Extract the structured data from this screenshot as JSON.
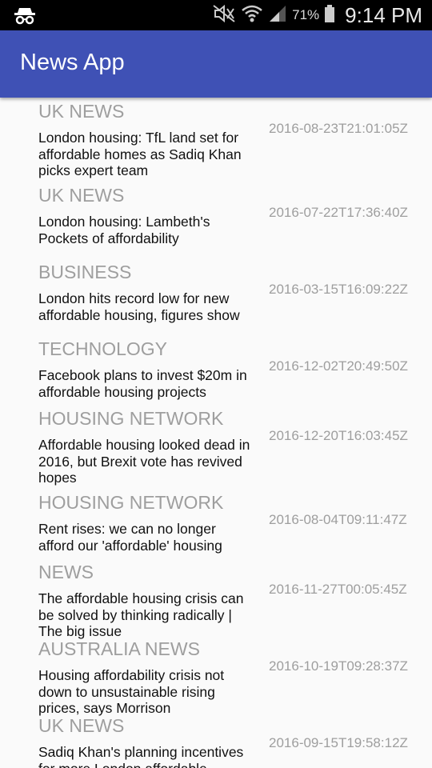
{
  "status_bar": {
    "battery": "71%",
    "time": "9:14 PM",
    "icons": [
      "incognito-icon",
      "mute-icon",
      "wifi-icon",
      "signal-icon",
      "battery-icon"
    ]
  },
  "app_bar": {
    "title": "News App",
    "color": "#3f51b5"
  },
  "articles": [
    {
      "section": "UK NEWS",
      "title": "London housing: TfL land set for affordable homes as Sadiq Khan picks expert team",
      "date": "2016-08-23T21:01:05Z"
    },
    {
      "section": "UK NEWS",
      "title": "London housing: Lambeth's Pockets of affordability",
      "date": "2016-07-22T17:36:40Z"
    },
    {
      "section": "BUSINESS",
      "title": "London hits record low for new affordable housing, figures show",
      "date": "2016-03-15T16:09:22Z"
    },
    {
      "section": "TECHNOLOGY",
      "title": "Facebook plans to invest $20m in affordable housing projects",
      "date": "2016-12-02T20:49:50Z"
    },
    {
      "section": "HOUSING NETWORK",
      "title": "Affordable housing looked dead in 2016, but Brexit vote has revived hopes",
      "date": "2016-12-20T16:03:45Z"
    },
    {
      "section": "HOUSING NETWORK",
      "title": "Rent rises: we can no longer afford our 'affordable' housing",
      "date": "2016-08-04T09:11:47Z"
    },
    {
      "section": "NEWS",
      "title": "The affordable housing crisis can be solved by thinking radically | The big issue",
      "date": "2016-11-27T00:05:45Z"
    },
    {
      "section": "AUSTRALIA NEWS",
      "title": "Housing affordability crisis not down to unsustainable rising prices, says Morrison",
      "date": "2016-10-19T09:28:37Z"
    },
    {
      "section": "UK NEWS",
      "title": "Sadiq Khan's planning incentives for more London affordable",
      "date": "2016-09-15T19:58:12Z"
    }
  ]
}
